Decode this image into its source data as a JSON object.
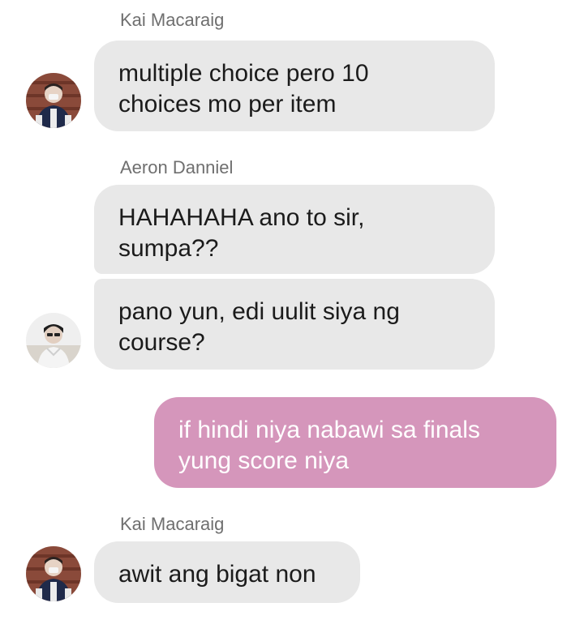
{
  "messages": [
    {
      "sender": "Kai Macaraig",
      "lines": [
        "multiple choice pero 10",
        "choices mo per item"
      ]
    },
    {
      "sender": "Aeron Danniel",
      "lines": [
        "HAHAHAHA ano to sir,",
        "sumpa??"
      ]
    },
    {
      "lines": [
        "pano yun, edi uulit siya ng",
        "course?"
      ]
    },
    {
      "lines": [
        "if hindi niya nabawi sa finals",
        "yung score niya"
      ],
      "outgoing": true
    },
    {
      "sender": "Kai Macaraig",
      "lines": [
        "awit ang bigat non"
      ]
    }
  ],
  "icons": {
    "avatar_kai": "avatar-kai-macaraig-icon",
    "avatar_aeron": "avatar-aeron-danniel-icon"
  },
  "colors": {
    "incoming_bubble": "#e8e8e8",
    "outgoing_bubble": "#d596bb",
    "sender_name": "#6f6f6f"
  }
}
